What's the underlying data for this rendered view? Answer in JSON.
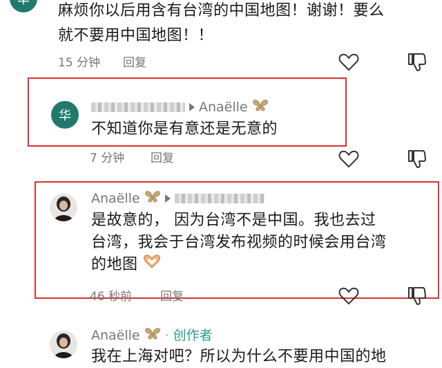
{
  "comments": [
    {
      "avatar_char": "华",
      "text_line1": "麻烦你以后用含有台湾的中国地图！谢谢！要么",
      "text_line2": "就不要用中国地图！！",
      "time": "15 分钟",
      "reply": "回复"
    },
    {
      "avatar_char": "华",
      "reply_to": "Anaëlle",
      "text": "不知道你是有意还是无意的",
      "time": "7 分钟",
      "reply": "回复"
    },
    {
      "author": "Anaëlle",
      "text_line1": "是故意的， 因为台湾不是中国。我也去过",
      "text_line2": "台湾，我会于台湾发布视频的时候会用台湾",
      "text_line3": "的地图",
      "time": "46 秒前",
      "reply": "回复"
    },
    {
      "author": "Anaëlle",
      "creator_badge": "创作者",
      "text": "我在上海对吧？所以为什么不要用中国的地"
    }
  ],
  "colors": {
    "highlight_border": "#d93030",
    "avatar_green": "#1f7a6b",
    "creator_teal": "#2a9b8e"
  }
}
